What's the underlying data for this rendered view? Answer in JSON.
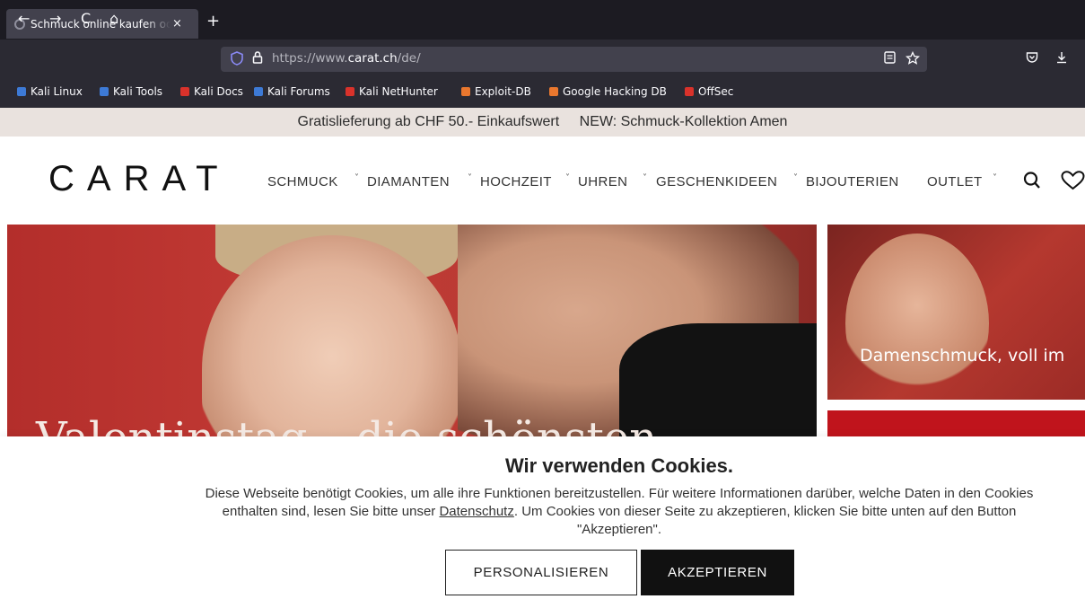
{
  "browser": {
    "tab_title": "Schmuck online kaufen oder",
    "tab_close": "×",
    "new_tab": "+",
    "nav": {
      "back": "←",
      "forward": "→",
      "reload": "C",
      "home": "⌂"
    },
    "url_prefix": "https://www.",
    "url_domain": "carat.ch",
    "url_path": "/de/",
    "icons": {
      "shield": "shield-icon",
      "lock": "lock-icon",
      "reader": "reader-view-icon",
      "bookmark": "star-icon",
      "pocket": "pocket-icon",
      "download": "download-icon"
    }
  },
  "bookmarks": [
    {
      "label": "Kali Linux",
      "color": "#3d7ad6"
    },
    {
      "label": "Kali Tools",
      "color": "#3d7ad6"
    },
    {
      "label": "Kali Docs",
      "color": "#d9322b"
    },
    {
      "label": "Kali Forums",
      "color": "#3d7ad6"
    },
    {
      "label": "Kali NetHunter",
      "color": "#d9322b"
    },
    {
      "label": "Exploit-DB",
      "color": "#e9772e"
    },
    {
      "label": "Google Hacking DB",
      "color": "#e9772e"
    },
    {
      "label": "OffSec",
      "color": "#d9322b"
    }
  ],
  "promo": {
    "left": "Gratislieferung ab CHF 50.- Einkaufswert",
    "right": "NEW: Schmuck-Kollektion Amen"
  },
  "header": {
    "logo": "CARAT",
    "menu": [
      "SCHMUCK",
      "DIAMANTEN",
      "HOCHZEIT",
      "UHREN",
      "GESCHENKIDEEN",
      "BIJOUTERIEN",
      "OUTLET"
    ],
    "chevron": "˅",
    "search_icon": "search-icon",
    "wishlist_icon": "heart-icon"
  },
  "hero": {
    "headline": "Valentinstag – die schönsten",
    "side_card_text": "Damenschmuck, voll im"
  },
  "cookie": {
    "title": "Wir verwenden Cookies.",
    "text_before": "Diese Webseite benötigt Cookies, um alle ihre Funktionen bereitzustellen. Für weitere Informationen darüber, welche Daten in den Cookies enthalten sind, lesen Sie bitte unser ",
    "link": "Datenschutz",
    "text_after": ". Um Cookies von dieser Seite zu akzeptieren, klicken Sie bitte unten auf den Button \"Akzeptieren\".",
    "personalize": "PERSONALISIEREN",
    "accept": "AKZEPTIEREN"
  }
}
